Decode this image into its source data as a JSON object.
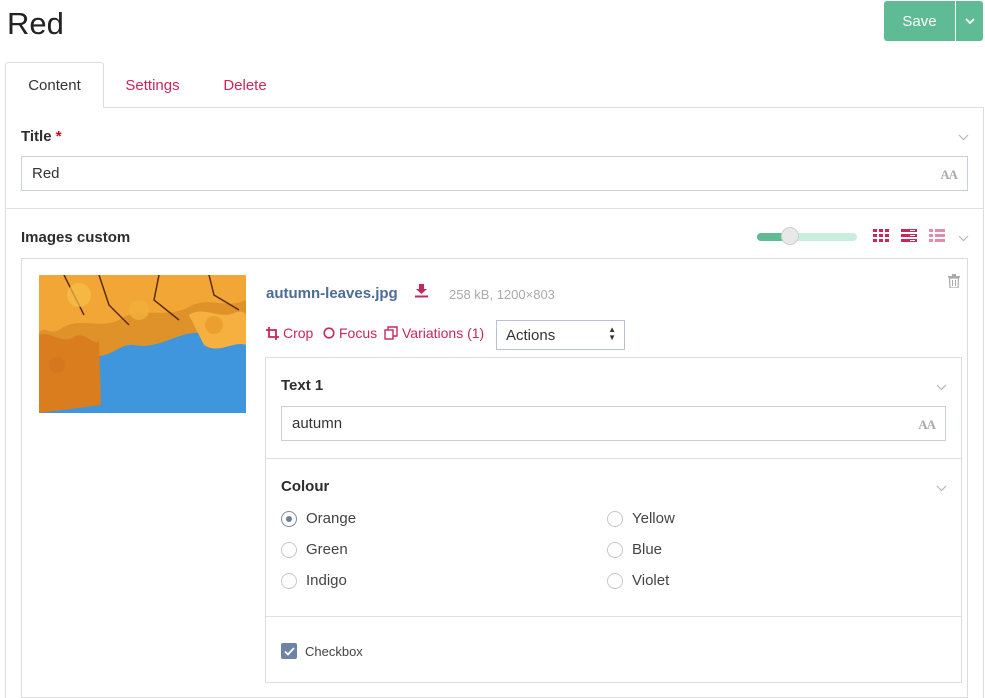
{
  "page": {
    "title": "Red"
  },
  "header": {
    "save_label": "Save"
  },
  "tabs": [
    {
      "label": "Content",
      "active": true
    },
    {
      "label": "Settings",
      "active": false
    },
    {
      "label": "Delete",
      "active": false
    }
  ],
  "title_field": {
    "label": "Title",
    "required_mark": "*",
    "value": "Red"
  },
  "images": {
    "label": "Images custom",
    "thumbnail_size_fraction": 0.33,
    "item": {
      "file_name": "autumn-leaves.jpg",
      "file_meta": "258 kB, 1200×803",
      "actions": {
        "crop": "Crop",
        "focus": "Focus",
        "variations": "Variations (1)",
        "select_value": "Actions"
      },
      "text1": {
        "label": "Text 1",
        "value": "autumn"
      },
      "colour": {
        "label": "Colour",
        "options": [
          "Orange",
          "Yellow",
          "Green",
          "Blue",
          "Indigo",
          "Violet"
        ],
        "selected": "Orange"
      },
      "checkbox": {
        "label": "Checkbox",
        "checked": true
      }
    }
  },
  "colors": {
    "accent": "#c9265a",
    "save": "#5ebb93",
    "link": "#4b6c96"
  }
}
